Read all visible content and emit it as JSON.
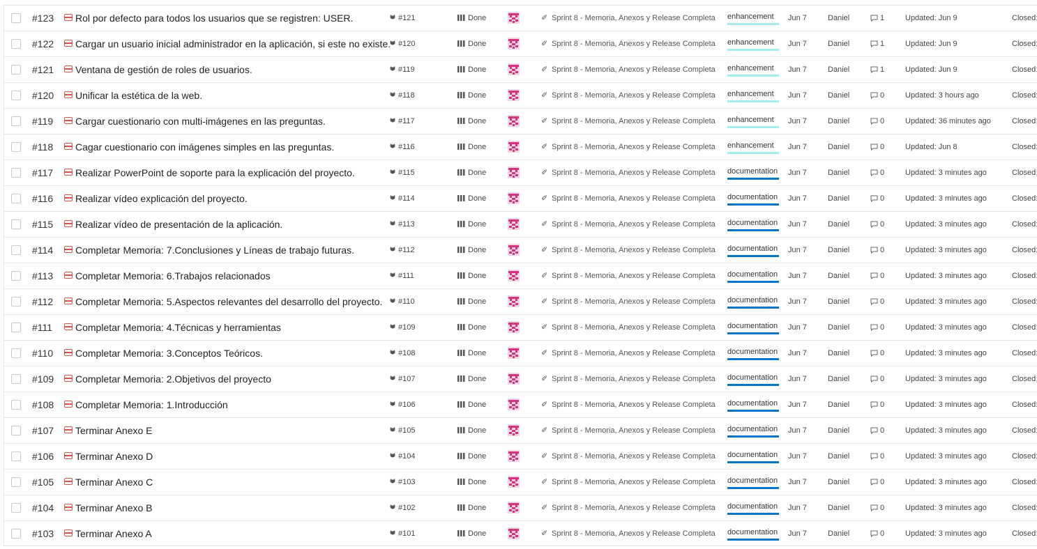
{
  "colors": {
    "enhancement": "#a2eeef",
    "documentation": "#0075ca",
    "type_icon": "#d9534f",
    "avatar": "#d6337f"
  },
  "issues": [
    {
      "num": "#123",
      "title": "Rol por defecto para todos los usuarios que se registren: USER.",
      "gh": "#121",
      "pipeline": "Done",
      "milestone": "Sprint 8 - Memoria, Anexos y Release Completa",
      "label": "enhancement",
      "label_type": "enhancement",
      "date": "Jun 7",
      "assignee": "Daniel",
      "comments": "1",
      "updated": "Updated: Jun 9",
      "closed": "Closed:"
    },
    {
      "num": "#122",
      "title": "Cargar un usuario inicial administrador en la aplicación, si este no existe.",
      "gh": "#120",
      "pipeline": "Done",
      "milestone": "Sprint 8 - Memoria, Anexos y Release Completa",
      "label": "enhancement",
      "label_type": "enhancement",
      "date": "Jun 7",
      "assignee": "Daniel",
      "comments": "1",
      "updated": "Updated: Jun 9",
      "closed": "Closed:"
    },
    {
      "num": "#121",
      "title": "Ventana de gestión de roles de usuarios.",
      "gh": "#119",
      "pipeline": "Done",
      "milestone": "Sprint 8 - Memoria, Anexos y Release Completa",
      "label": "enhancement",
      "label_type": "enhancement",
      "date": "Jun 7",
      "assignee": "Daniel",
      "comments": "1",
      "updated": "Updated: Jun 9",
      "closed": "Closed:"
    },
    {
      "num": "#120",
      "title": "Unificar la estética de la web.",
      "gh": "#118",
      "pipeline": "Done",
      "milestone": "Sprint 8 - Memoria, Anexos y Release Completa",
      "label": "enhancement",
      "label_type": "enhancement",
      "date": "Jun 7",
      "assignee": "Daniel",
      "comments": "0",
      "updated": "Updated: 3 hours ago",
      "closed": "Closed:"
    },
    {
      "num": "#119",
      "title": "Cargar cuestionario con multi-imágenes en las preguntas.",
      "gh": "#117",
      "pipeline": "Done",
      "milestone": "Sprint 8 - Memoria, Anexos y Release Completa",
      "label": "enhancement",
      "label_type": "enhancement",
      "date": "Jun 7",
      "assignee": "Daniel",
      "comments": "0",
      "updated": "Updated: 36 minutes ago",
      "closed": "Closed:"
    },
    {
      "num": "#118",
      "title": "Cagar cuestionario con imágenes simples en las preguntas.",
      "gh": "#116",
      "pipeline": "Done",
      "milestone": "Sprint 8 - Memoria, Anexos y Release Completa",
      "label": "enhancement",
      "label_type": "enhancement",
      "date": "Jun 7",
      "assignee": "Daniel",
      "comments": "0",
      "updated": "Updated: Jun 8",
      "closed": "Closed:"
    },
    {
      "num": "#117",
      "title": "Realizar PowerPoint de soporte para la explicación del proyecto.",
      "gh": "#115",
      "pipeline": "Done",
      "milestone": "Sprint 8 - Memoria, Anexos y Release Completa",
      "label": "documentation",
      "label_type": "documentation",
      "date": "Jun 7",
      "assignee": "Daniel",
      "comments": "0",
      "updated": "Updated: 3 minutes ago",
      "closed": "Closed:"
    },
    {
      "num": "#116",
      "title": "Realizar vídeo explicación del proyecto.",
      "gh": "#114",
      "pipeline": "Done",
      "milestone": "Sprint 8 - Memoria, Anexos y Release Completa",
      "label": "documentation",
      "label_type": "documentation",
      "date": "Jun 7",
      "assignee": "Daniel",
      "comments": "0",
      "updated": "Updated: 3 minutes ago",
      "closed": "Closed:"
    },
    {
      "num": "#115",
      "title": "Realizar vídeo de presentación de la aplicación.",
      "gh": "#113",
      "pipeline": "Done",
      "milestone": "Sprint 8 - Memoria, Anexos y Release Completa",
      "label": "documentation",
      "label_type": "documentation",
      "date": "Jun 7",
      "assignee": "Daniel",
      "comments": "0",
      "updated": "Updated: 3 minutes ago",
      "closed": "Closed:"
    },
    {
      "num": "#114",
      "title": "Completar Memoria: 7.Conclusiones y Líneas de trabajo futuras.",
      "gh": "#112",
      "pipeline": "Done",
      "milestone": "Sprint 8 - Memoria, Anexos y Release Completa",
      "label": "documentation",
      "label_type": "documentation",
      "date": "Jun 7",
      "assignee": "Daniel",
      "comments": "0",
      "updated": "Updated: 3 minutes ago",
      "closed": "Closed:"
    },
    {
      "num": "#113",
      "title": "Completar Memoria: 6.Trabajos relacionados",
      "gh": "#111",
      "pipeline": "Done",
      "milestone": "Sprint 8 - Memoria, Anexos y Release Completa",
      "label": "documentation",
      "label_type": "documentation",
      "date": "Jun 7",
      "assignee": "Daniel",
      "comments": "0",
      "updated": "Updated: 3 minutes ago",
      "closed": "Closed:"
    },
    {
      "num": "#112",
      "title": "Completar Memoria: 5.Aspectos relevantes del desarrollo del proyecto.",
      "gh": "#110",
      "pipeline": "Done",
      "milestone": "Sprint 8 - Memoria, Anexos y Release Completa",
      "label": "documentation",
      "label_type": "documentation",
      "date": "Jun 7",
      "assignee": "Daniel",
      "comments": "0",
      "updated": "Updated: 3 minutes ago",
      "closed": "Closed:"
    },
    {
      "num": "#111",
      "title": "Completar Memoria: 4.Técnicas y herramientas",
      "gh": "#109",
      "pipeline": "Done",
      "milestone": "Sprint 8 - Memoria, Anexos y Release Completa",
      "label": "documentation",
      "label_type": "documentation",
      "date": "Jun 7",
      "assignee": "Daniel",
      "comments": "0",
      "updated": "Updated: 3 minutes ago",
      "closed": "Closed:"
    },
    {
      "num": "#110",
      "title": "Completar Memoria: 3.Conceptos Teóricos.",
      "gh": "#108",
      "pipeline": "Done",
      "milestone": "Sprint 8 - Memoria, Anexos y Release Completa",
      "label": "documentation",
      "label_type": "documentation",
      "date": "Jun 7",
      "assignee": "Daniel",
      "comments": "0",
      "updated": "Updated: 3 minutes ago",
      "closed": "Closed:"
    },
    {
      "num": "#109",
      "title": "Completar Memoria: 2.Objetivos del proyecto",
      "gh": "#107",
      "pipeline": "Done",
      "milestone": "Sprint 8 - Memoria, Anexos y Release Completa",
      "label": "documentation",
      "label_type": "documentation",
      "date": "Jun 7",
      "assignee": "Daniel",
      "comments": "0",
      "updated": "Updated: 3 minutes ago",
      "closed": "Closed:"
    },
    {
      "num": "#108",
      "title": "Completar Memoria: 1.Introducción",
      "gh": "#106",
      "pipeline": "Done",
      "milestone": "Sprint 8 - Memoria, Anexos y Release Completa",
      "label": "documentation",
      "label_type": "documentation",
      "date": "Jun 7",
      "assignee": "Daniel",
      "comments": "0",
      "updated": "Updated: 3 minutes ago",
      "closed": "Closed:"
    },
    {
      "num": "#107",
      "title": "Terminar Anexo E",
      "gh": "#105",
      "pipeline": "Done",
      "milestone": "Sprint 8 - Memoria, Anexos y Release Completa",
      "label": "documentation",
      "label_type": "documentation",
      "date": "Jun 7",
      "assignee": "Daniel",
      "comments": "0",
      "updated": "Updated: 3 minutes ago",
      "closed": "Closed:"
    },
    {
      "num": "#106",
      "title": "Terminar Anexo D",
      "gh": "#104",
      "pipeline": "Done",
      "milestone": "Sprint 8 - Memoria, Anexos y Release Completa",
      "label": "documentation",
      "label_type": "documentation",
      "date": "Jun 7",
      "assignee": "Daniel",
      "comments": "0",
      "updated": "Updated: 3 minutes ago",
      "closed": "Closed:"
    },
    {
      "num": "#105",
      "title": "Terminar Anexo C",
      "gh": "#103",
      "pipeline": "Done",
      "milestone": "Sprint 8 - Memoria, Anexos y Release Completa",
      "label": "documentation",
      "label_type": "documentation",
      "date": "Jun 7",
      "assignee": "Daniel",
      "comments": "0",
      "updated": "Updated: 3 minutes ago",
      "closed": "Closed:"
    },
    {
      "num": "#104",
      "title": "Terminar Anexo B",
      "gh": "#102",
      "pipeline": "Done",
      "milestone": "Sprint 8 - Memoria, Anexos y Release Completa",
      "label": "documentation",
      "label_type": "documentation",
      "date": "Jun 7",
      "assignee": "Daniel",
      "comments": "0",
      "updated": "Updated: 3 minutes ago",
      "closed": "Closed:"
    },
    {
      "num": "#103",
      "title": "Terminar Anexo A",
      "gh": "#101",
      "pipeline": "Done",
      "milestone": "Sprint 8 - Memoria, Anexos y Release Completa",
      "label": "documentation",
      "label_type": "documentation",
      "date": "Jun 7",
      "assignee": "Daniel",
      "comments": "0",
      "updated": "Updated: 3 minutes ago",
      "closed": "Closed:"
    }
  ]
}
